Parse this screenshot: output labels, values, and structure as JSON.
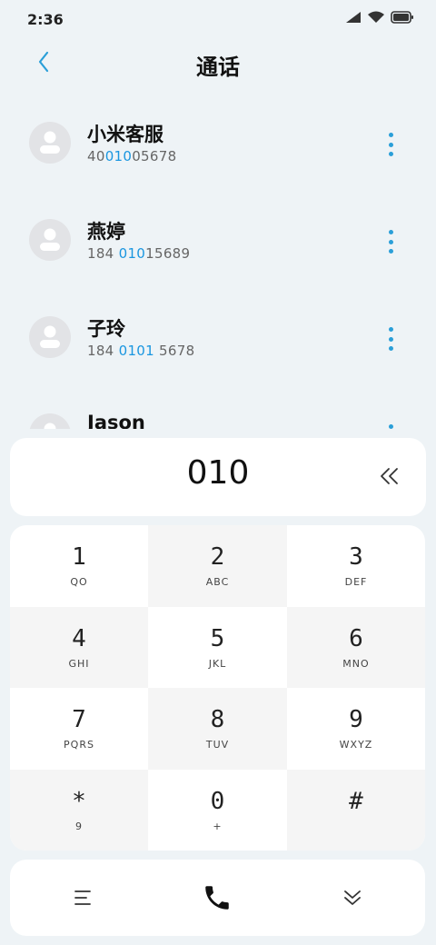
{
  "status_bar": {
    "time": "2:36"
  },
  "header": {
    "title": "通话"
  },
  "contacts": [
    {
      "name": "小米客服",
      "number_pre": "40",
      "number_hl": "010",
      "number_post": "05678"
    },
    {
      "name": "燕婷",
      "number_pre": "184 ",
      "number_hl": "010",
      "number_post": "15689"
    },
    {
      "name": "子玲",
      "number_pre": "184 ",
      "number_hl": "0101",
      "number_post": " 5678"
    },
    {
      "name": "Jason",
      "number_pre": "",
      "number_hl": "",
      "number_post": ""
    }
  ],
  "dialer": {
    "input": "010"
  },
  "keypad": {
    "keys": [
      {
        "digit": "1",
        "letters": "QO"
      },
      {
        "digit": "2",
        "letters": "ABC"
      },
      {
        "digit": "3",
        "letters": "DEF"
      },
      {
        "digit": "4",
        "letters": "GHI"
      },
      {
        "digit": "5",
        "letters": "JKL"
      },
      {
        "digit": "6",
        "letters": "MNO"
      },
      {
        "digit": "7",
        "letters": "PQRS"
      },
      {
        "digit": "8",
        "letters": "TUV"
      },
      {
        "digit": "9",
        "letters": "WXYZ"
      },
      {
        "digit": "*",
        "letters": "9"
      },
      {
        "digit": "0",
        "letters": "+"
      },
      {
        "digit": "#",
        "letters": ""
      }
    ]
  },
  "colors": {
    "accent": "#2a9fd8",
    "highlight": "#1a96e0",
    "background": "#eef3f6"
  },
  "icons": {
    "back": "chevron-left-icon",
    "more": "more-vertical-icon",
    "backspace": "double-chevron-left-icon",
    "menu": "menu-icon",
    "call": "phone-icon",
    "collapse": "double-chevron-down-icon"
  }
}
